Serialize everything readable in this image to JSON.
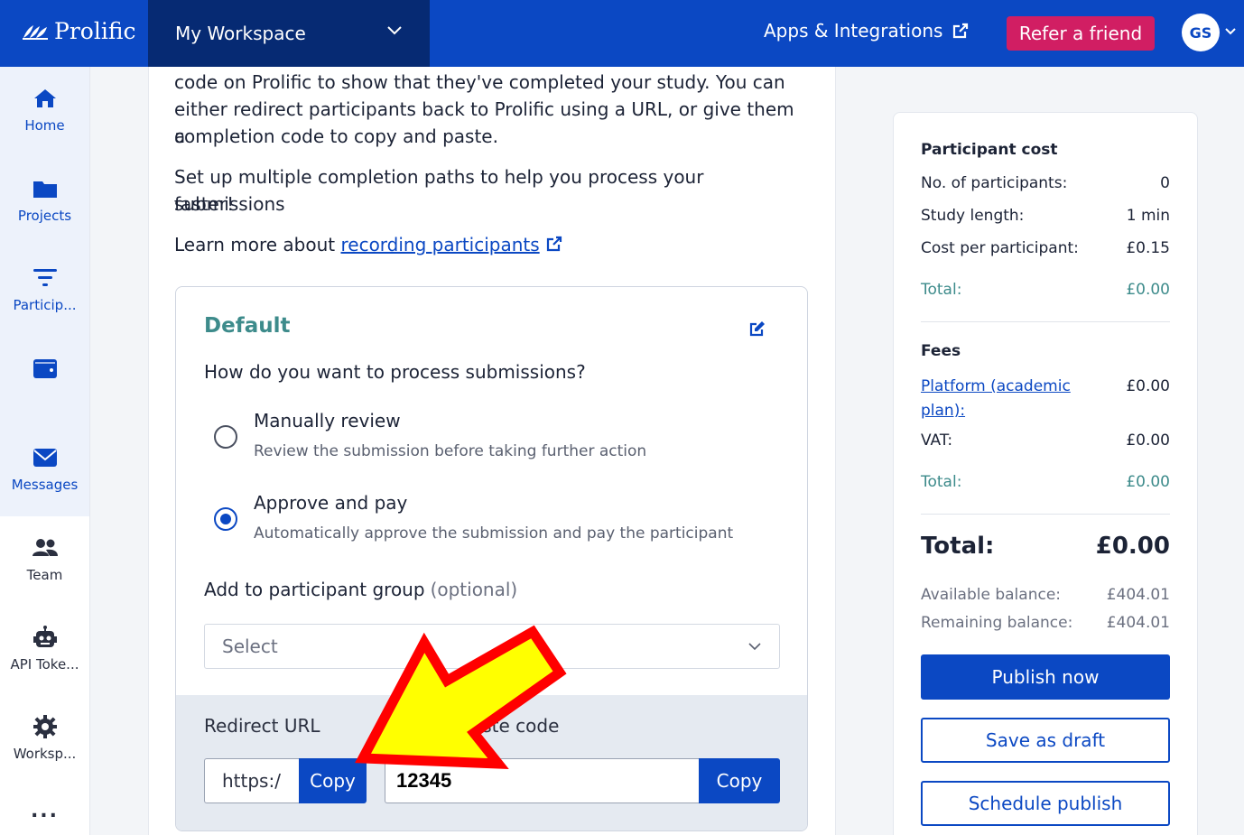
{
  "topbar": {
    "brand": "Prolific",
    "workspace": "My Workspace",
    "apps": "Apps & Integrations",
    "refer": "Refer a friend",
    "avatar": "GS"
  },
  "sidebar": {
    "items": [
      {
        "label": "Home",
        "icon": "home-icon"
      },
      {
        "label": "Projects",
        "icon": "folder-icon"
      },
      {
        "label": "Particip...",
        "icon": "filter-icon"
      },
      {
        "label": "",
        "icon": "wallet-icon"
      },
      {
        "label": "Messages",
        "icon": "envelope-icon"
      },
      {
        "label": "Team",
        "icon": "users-icon"
      },
      {
        "label": "API Toke...",
        "icon": "robot-icon"
      },
      {
        "label": "Worksp...",
        "icon": "gear-icon"
      },
      {
        "label": "...",
        "icon": "more-icon"
      }
    ]
  },
  "main": {
    "intro_line1": "code on Prolific to show that they've completed your study. You can",
    "intro_line2": "either redirect participants back to Prolific using a URL, or give them a",
    "intro_line3": "completion code to copy and paste.",
    "multi_line1": "Set up multiple completion paths to help you process your submissions",
    "multi_line2": "faster!",
    "learn_prefix": "Learn more about ",
    "learn_link": "recording participants",
    "path": {
      "title": "Default",
      "question": "How do you want to process submissions?",
      "options": [
        {
          "title": "Manually review",
          "desc": "Review the submission before taking further action",
          "selected": false
        },
        {
          "title": "Approve and pay",
          "desc": "Automatically approve the submission and pay the participant",
          "selected": true
        }
      ],
      "group_label": "Add to participant group",
      "group_optional": "(optional)",
      "select_placeholder": "Select",
      "redirect_label": "Redirect URL",
      "redirect_value": "https:/",
      "copy_label": "Copy",
      "paste_label": "aste code",
      "code_value": "12345"
    }
  },
  "cost": {
    "participant_heading": "Participant cost",
    "rows": [
      {
        "label": "No. of participants:",
        "value": "0"
      },
      {
        "label": "Study length:",
        "value": "1 min"
      },
      {
        "label": "Cost per participant:",
        "value": "£0.15"
      }
    ],
    "participant_total": {
      "label": "Total:",
      "value": "£0.00"
    },
    "fees_heading": "Fees",
    "platform_label_1": "Platform (academic",
    "platform_label_2": "plan):",
    "platform_value": "£0.00",
    "vat": {
      "label": "VAT:",
      "value": "£0.00"
    },
    "fees_total": {
      "label": "Total:",
      "value": "£0.00"
    },
    "grand_total": {
      "label": "Total:",
      "value": "£0.00"
    },
    "available": {
      "label": "Available balance:",
      "value": "£404.01"
    },
    "remaining": {
      "label": "Remaining balance:",
      "value": "£404.01"
    },
    "publish": "Publish now",
    "save_draft": "Save as draft",
    "schedule": "Schedule publish"
  },
  "colors": {
    "brand_blue": "#0b48c3",
    "workspace_navy": "#062a73",
    "refer_pink": "#d11e63",
    "teal": "#3d8b8b",
    "arrow_yellow": "#ffff00",
    "arrow_red": "#ff0000"
  }
}
